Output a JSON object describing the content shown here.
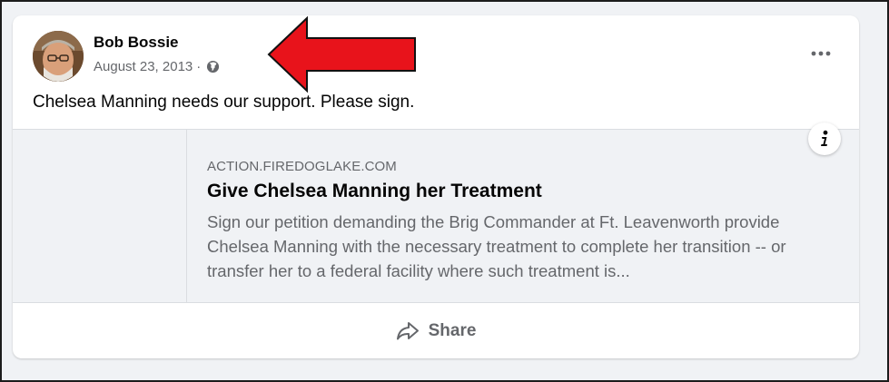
{
  "post": {
    "author": "Bob Bossie",
    "date": "August 23, 2013",
    "separator": "·",
    "privacy_icon": "globe-icon",
    "more_icon": "more-options-icon",
    "text": "Chelsea Manning needs our support. Please sign."
  },
  "link_preview": {
    "domain": "ACTION.FIREDOGLAKE.COM",
    "title": "Give Chelsea Manning her Treatment",
    "description": "Sign our petition demanding the Brig Commander at Ft. Leavenworth provide Chelsea Manning with the necessary treatment to complete her transition -- or transfer her to a federal facility where such treatment is...",
    "info_icon": "info-icon"
  },
  "actions": {
    "share_label": "Share",
    "share_icon": "share-arrow-icon"
  },
  "colors": {
    "background": "#f0f2f5",
    "card": "#ffffff",
    "secondary_text": "#65676b",
    "annotation_arrow": "#e8131b"
  }
}
